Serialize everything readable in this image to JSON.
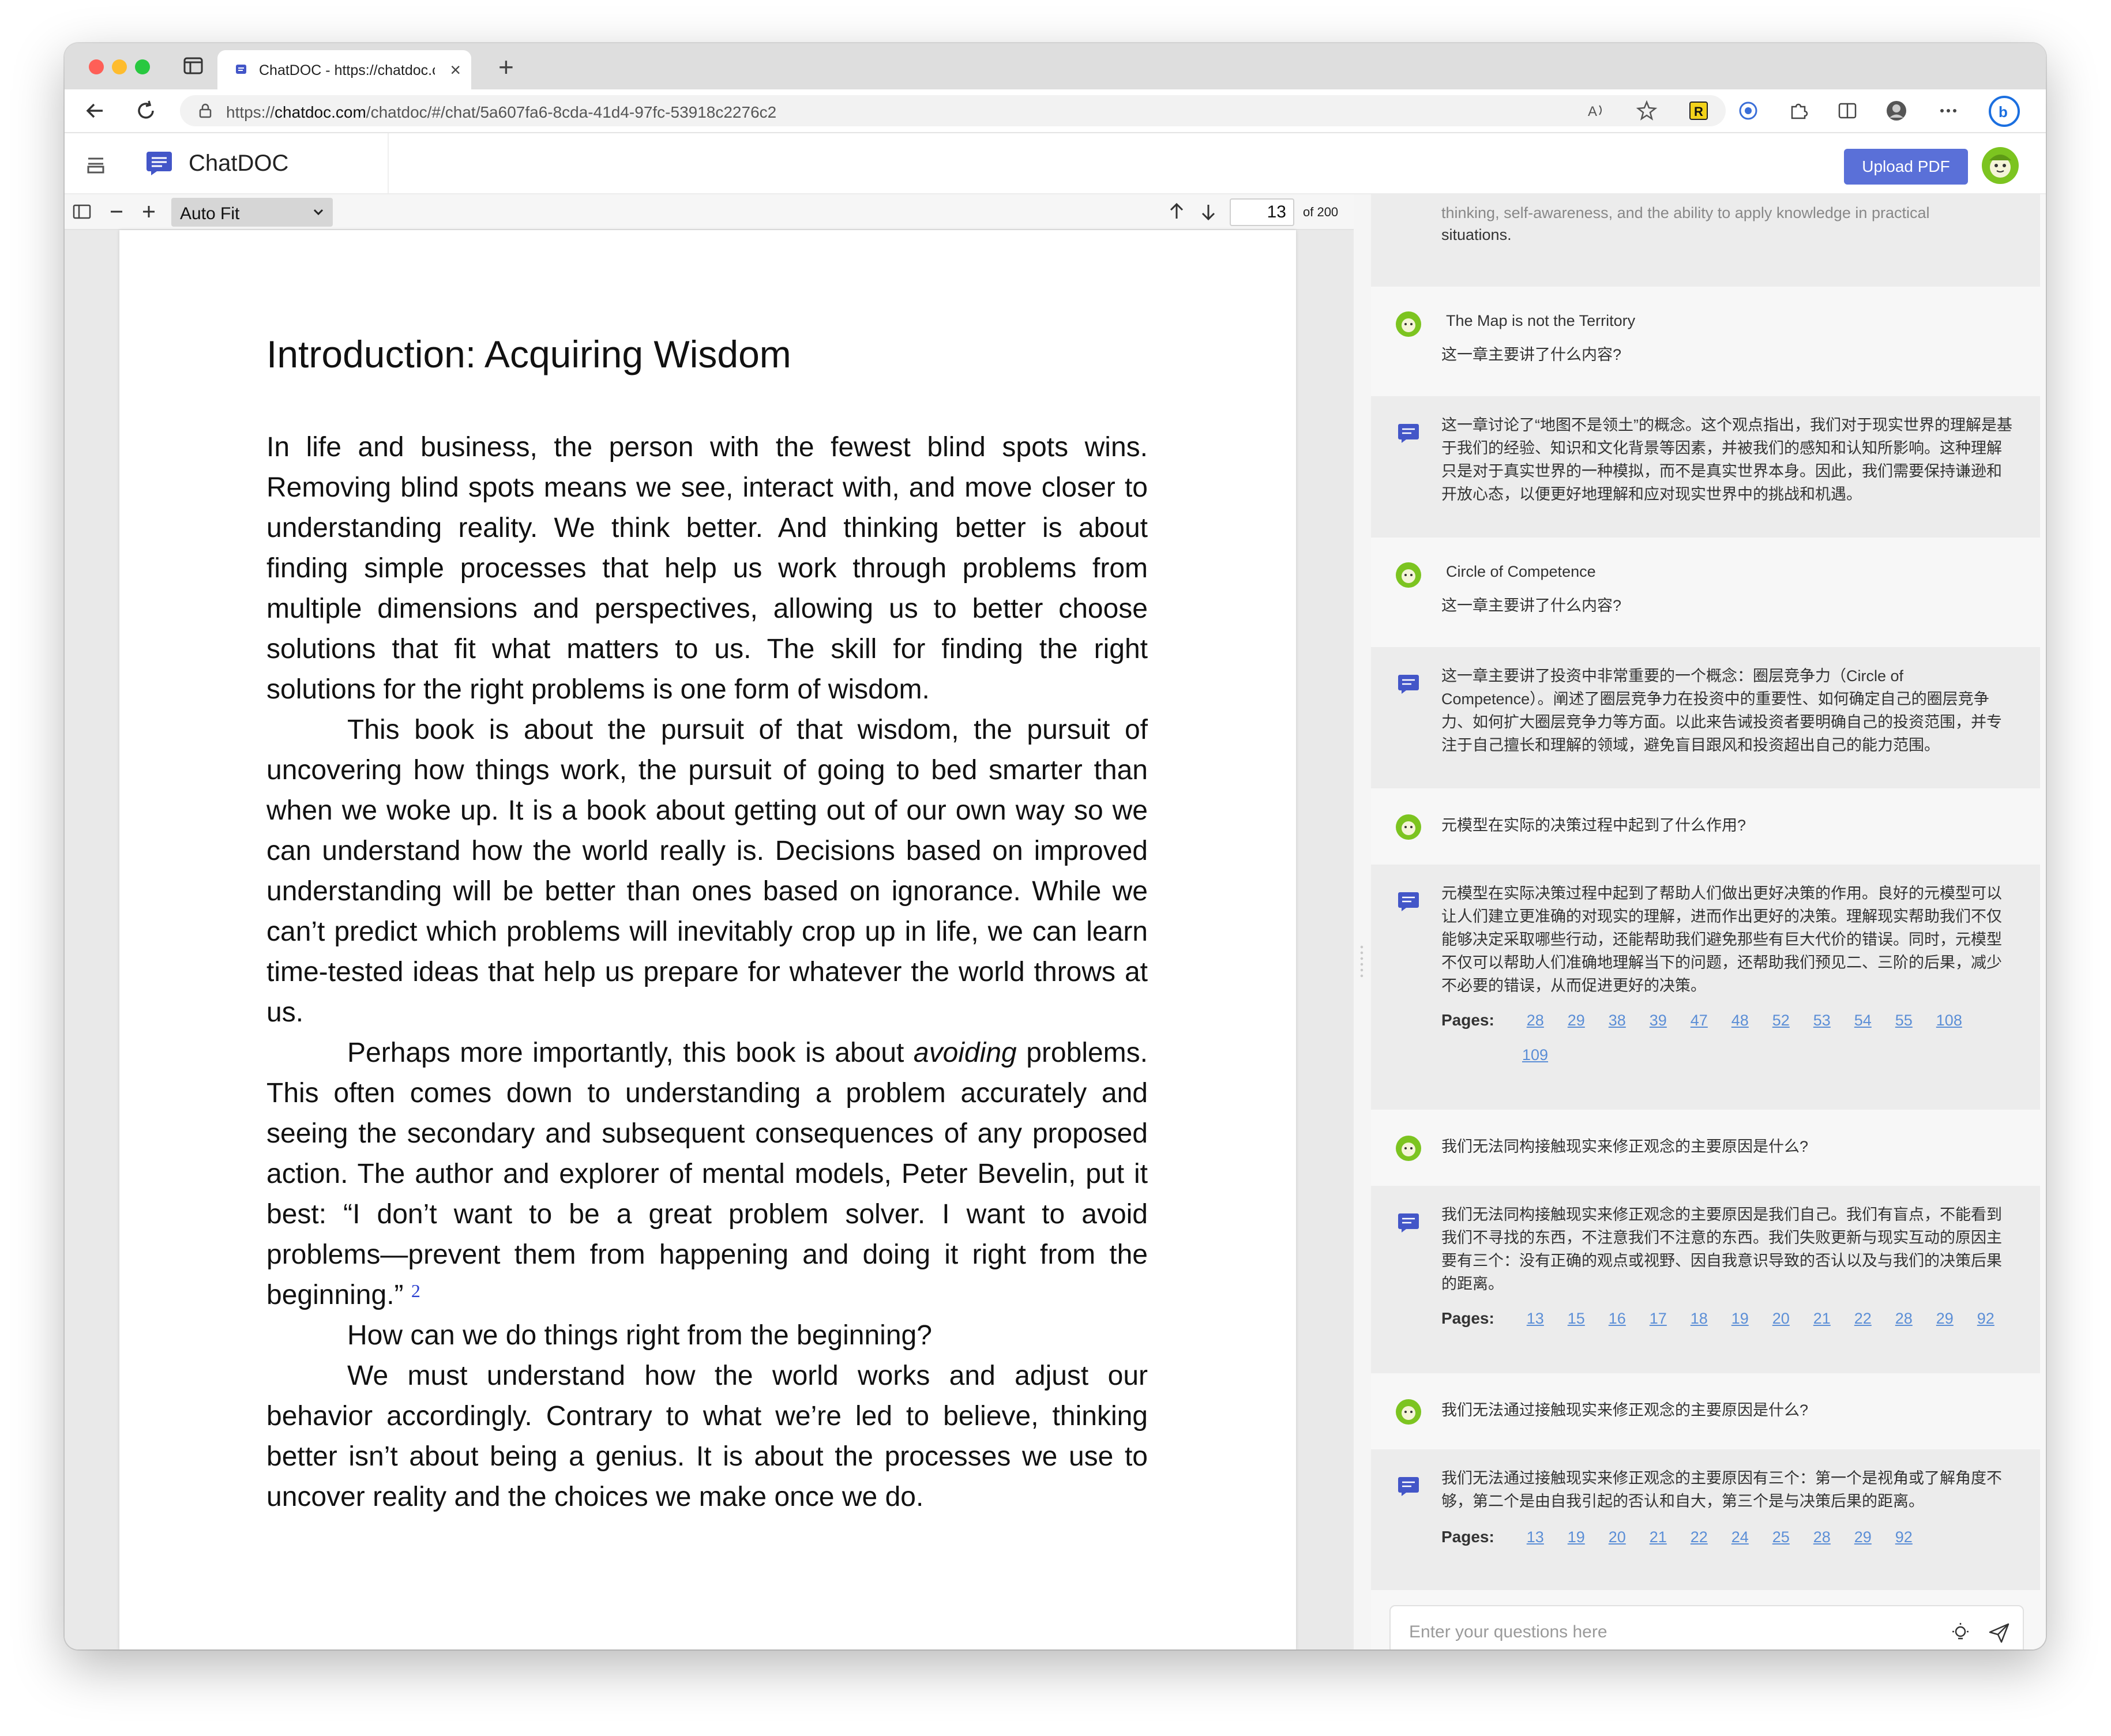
{
  "browser": {
    "tab_title": "ChatDOC - https://chatdoc.com",
    "tab_close": "×",
    "new_tab": "+",
    "url_scheme": "https://",
    "url_host": "chatdoc.com",
    "url_path": "/chatdoc/#/chat/5a607fa6-8cda-41d4-97fc-53918c2276c2"
  },
  "app": {
    "title": "ChatDOC",
    "upload_label": "Upload PDF"
  },
  "pdf_toolbar": {
    "zoom_out": "−",
    "zoom_in": "+",
    "zoom_value": "Auto Fit",
    "page_current": "13",
    "page_total": "of 200"
  },
  "document": {
    "heading": "Introduction: Acquiring Wisdom",
    "p1": "In life and business, the person with the fewest blind spots wins. Removing blind spots means we see, interact with, and move closer to understanding reality. We think better. And thinking better is about finding simple processes that help us work through problems from multiple dimensions and perspectives, allowing us to better choose solutions that fit what matters to us. The skill for finding the right solutions for the right problems is one form of wisdom.",
    "p2": "This book is about the pursuit of that wisdom, the pursuit of uncovering how things work, the pursuit of going to bed smarter than when we woke up. It is a book about getting out of our own way so we can understand how the world really is. Decisions based on improved understanding will be better than ones based on ignorance. While we can’t predict which problems will inevitably crop up in life, we can learn time-tested ideas that help us prepare for whatever the world throws at us.",
    "p3_a": "Perhaps more importantly, this book is about ",
    "p3_em": "avoiding",
    "p3_b": " problems. This often comes down to understanding a problem accurately and seeing the secondary and subsequent consequences of any proposed action. The author and explorer of mental models, Peter Bevelin, put it best: “I don’t want to be a great problem solver. I want to avoid problems—prevent them from happening and doing it right from the beginning.” ",
    "p3_fn": "2",
    "p4": "How can we do things right from the beginning?",
    "p5": "We must understand how the world works and adjust our behavior accordingly. Contrary to what we’re led to believe, thinking better isn’t about being a genius. It is about the processes we use to uncover reality and the choices we make once we do."
  },
  "chat": {
    "partial_top_1": "thinking, self-awareness, and the ability to apply knowledge in practical",
    "partial_top_2": "situations.",
    "q1_title": "The Map is not the Territory",
    "q1_text": "这一章主要讲了什么内容?",
    "a1_text": "这一章讨论了“地图不是领土”的概念。这个观点指出，我们对于现实世界的理解是基于我们的经验、知识和文化背景等因素，并被我们的感知和认知所影响。这种理解只是对于真实世界的一种模拟，而不是真实世界本身。因此，我们需要保持谦逊和开放心态，以便更好地理解和应对现实世界中的挑战和机遇。",
    "q2_title": "Circle of Competence",
    "q2_text": "这一章主要讲了什么内容?",
    "a2_text": "这一章主要讲了投资中非常重要的一个概念：圈层竞争力（Circle of Competence）。阐述了圈层竞争力在投资中的重要性、如何确定自己的圈层竞争力、如何扩大圈层竞争力等方面。以此来告诫投资者要明确自己的投资范围，并专注于自己擅长和理解的领域，避免盲目跟风和投资超出自己的能力范围。",
    "q3_text": "元模型在实际的决策过程中起到了什么作用?",
    "a3_text": "元模型在实际决策过程中起到了帮助人们做出更好决策的作用。良好的元模型可以让人们建立更准确的对现实的理解，进而作出更好的决策。理解现实帮助我们不仅能够决定采取哪些行动，还能帮助我们避免那些有巨大代价的错误。同时，元模型不仅可以帮助人们准确地理解当下的问题，还帮助我们预见二、三阶的后果，减少不必要的错误，从而促进更好的决策。",
    "pages_label": "Pages:",
    "a3_pages": [
      "28",
      "29",
      "38",
      "39",
      "47",
      "48",
      "52",
      "53",
      "54",
      "55",
      "108",
      "109"
    ],
    "q4_text": "我们无法同构接触现实来修正观念的主要原因是什么?",
    "a4_text": "我们无法同构接触现实来修正观念的主要原因是我们自己。我们有盲点，不能看到我们不寻找的东西，不注意我们不注意的东西。我们失败更新与现实互动的原因主要有三个：没有正确的观点或视野、因自我意识导致的否认以及与我们的决策后果的距离。",
    "a4_pages": [
      "13",
      "15",
      "16",
      "17",
      "18",
      "19",
      "20",
      "21",
      "22",
      "28",
      "29",
      "92"
    ],
    "q5_text": "我们无法通过接触现实来修正观念的主要原因是什么?",
    "a5_text": "我们无法通过接触现实来修正观念的主要原因有三个：第一个是视角或了解角度不够，第二个是由自我引起的否认和自大，第三个是与决策后果的距离。",
    "a5_pages": [
      "13",
      "19",
      "20",
      "21",
      "22",
      "24",
      "25",
      "28",
      "29",
      "92"
    ],
    "input_placeholder": "Enter your questions here"
  },
  "colors": {
    "accent": "#5a70d8",
    "link": "#5b8ed6",
    "answer_bg": "#ececec",
    "user_icon": "#7cc420"
  }
}
